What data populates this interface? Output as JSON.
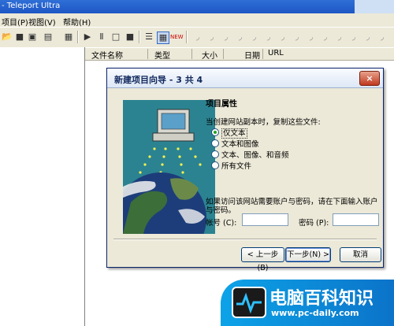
{
  "window": {
    "title": "- Teleport Ultra"
  },
  "menus": [
    "项目(P)",
    "视图(V)",
    "帮助(H)"
  ],
  "list_columns": [
    "文件名称",
    "类型",
    "大小",
    "日期",
    "URL"
  ],
  "dialog": {
    "title": "新建项目向导 - 3 共 4",
    "close_label": "×",
    "heading": "项目属性",
    "instruction": "当创建网站副本时，复制这些文件:",
    "options": [
      {
        "label": "仅文本",
        "selected": true
      },
      {
        "label": "文本和图像",
        "selected": false
      },
      {
        "label": "文本、图像、和音频",
        "selected": false
      },
      {
        "label": "所有文件",
        "selected": false
      }
    ],
    "account_note": "如果访问该网站需要账户与密码，请在下面输入账户与密码。",
    "account_label": "帐号 (C):",
    "password_label": "密码 (P):",
    "account_value": "",
    "password_value": "",
    "buttons": {
      "back": "< 上一步(B)",
      "next": "下一步(N) >",
      "cancel": "取消"
    }
  },
  "watermark": {
    "title": "电脑百科知识",
    "url": "www.pc-daily.com"
  }
}
